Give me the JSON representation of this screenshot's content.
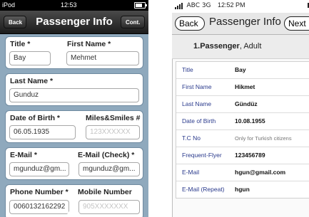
{
  "left": {
    "status": {
      "carrier": "iPod",
      "time": "12:53"
    },
    "nav": {
      "back_label": "Back",
      "title": "Passenger Info",
      "cont_label": "Cont."
    },
    "fields": {
      "title": {
        "label": "Title *",
        "value": "Bay"
      },
      "first_name": {
        "label": "First Name *",
        "value": "Mehmet"
      },
      "last_name": {
        "label": "Last Name  *",
        "value": "Gunduz"
      },
      "dob": {
        "label": "Date of Birth  *",
        "value": "06.05.1935"
      },
      "miles": {
        "label": "Miles&Smiles #",
        "placeholder": "123XXXXXX"
      },
      "email": {
        "label": "E-Mail *",
        "value": "mgunduz@gm..."
      },
      "email_check": {
        "label": "E-Mail (Check) *",
        "value": "mgunduz@gm..."
      },
      "phone": {
        "label": "Phone Number *",
        "value": "0060132162292"
      },
      "mobile": {
        "label": "Mobile Number",
        "placeholder": "905XXXXXXX"
      }
    },
    "colors": {
      "background": "#8fa9bd",
      "navbar": "#2b2b2b"
    }
  },
  "right": {
    "status": {
      "carrier": "ABC 3G",
      "time": "12:52 PM"
    },
    "nav": {
      "back_label": "Back",
      "title": "Passenger Info",
      "next_label": "Next"
    },
    "header": {
      "number": "1.",
      "passenger": "Passenger",
      "type": ", Adult"
    },
    "rows": [
      {
        "key": "Title",
        "value": "Bay"
      },
      {
        "key": "First Name",
        "value": "Hikmet"
      },
      {
        "key": "Last Name",
        "value": "Gündüz"
      },
      {
        "key": "Date of Birth",
        "value": "10.08.1955"
      },
      {
        "key": "T.C No",
        "value": "Only for Turkish citizens"
      },
      {
        "key": "Frequent-Flyer",
        "value": "123456789"
      },
      {
        "key": "E-Mail",
        "value": "hgun@gmail.com"
      },
      {
        "key": "E-Mail (Repeat)",
        "value": "hgun"
      }
    ]
  }
}
